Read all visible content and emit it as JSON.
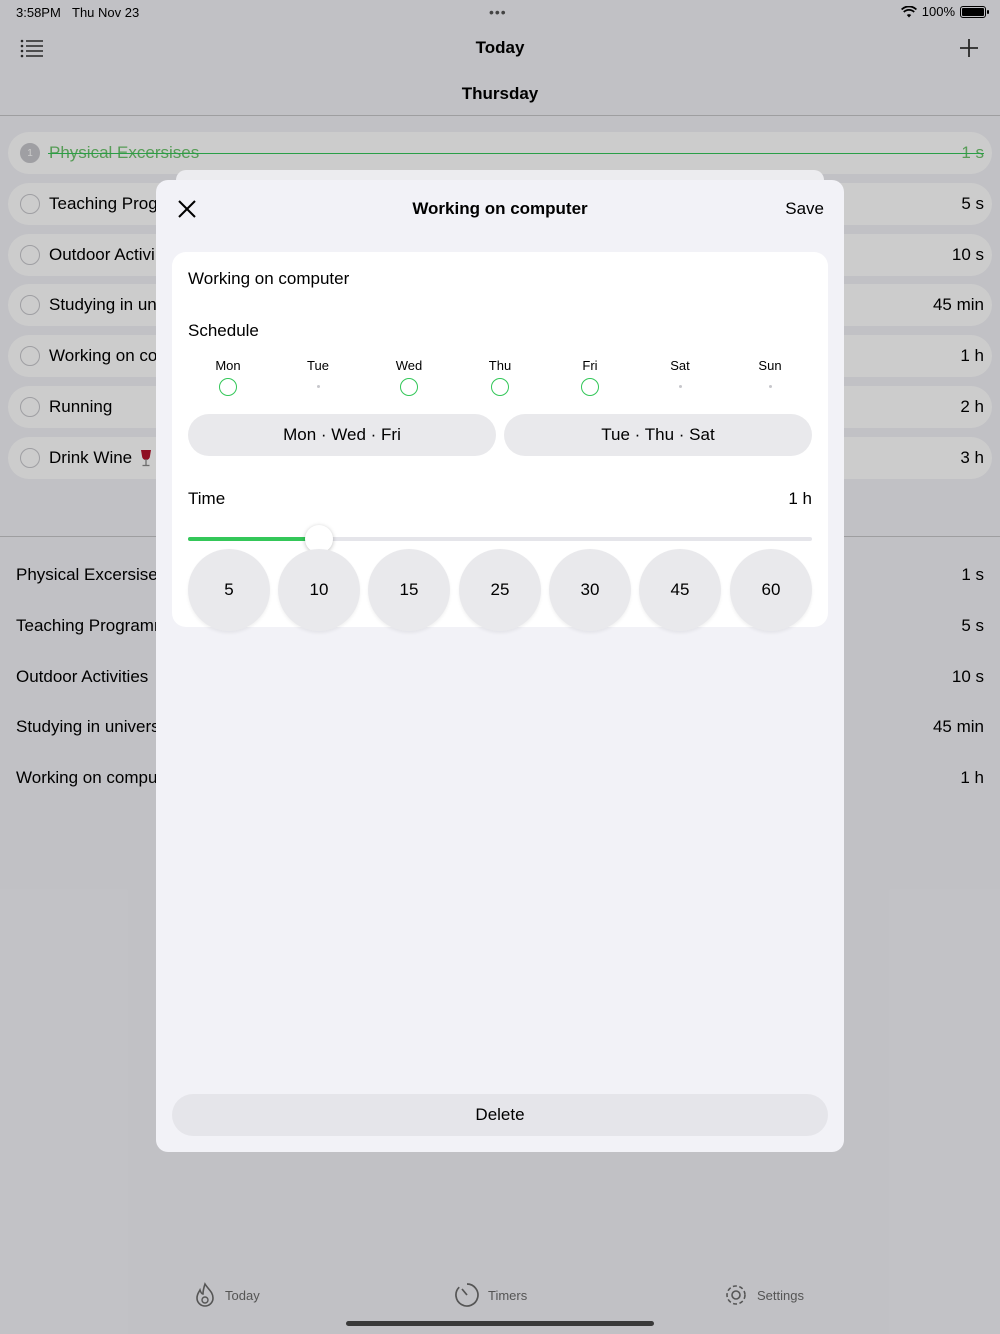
{
  "status_bar": {
    "time": "3:58PM",
    "date": "Thu Nov 23",
    "battery": "100%"
  },
  "nav": {
    "title": "Today",
    "day": "Thursday"
  },
  "tasks": [
    {
      "name": "Physical Excersises",
      "time": "1 s",
      "done": true,
      "index": "1"
    },
    {
      "name": "Teaching Prog",
      "time": "5 s"
    },
    {
      "name": "Outdoor Activi",
      "time": "10 s"
    },
    {
      "name": "Studying in un",
      "time": "45 min"
    },
    {
      "name": "Working on co",
      "time": "1 h"
    },
    {
      "name": "Running",
      "time": "2 h"
    },
    {
      "name": "Drink Wine",
      "time": "3 h"
    }
  ],
  "timers": [
    {
      "name": "Physical Excersises",
      "time": "1 s"
    },
    {
      "name": "Teaching Programr",
      "time": "5 s"
    },
    {
      "name": "Outdoor Activities",
      "time": "10 s"
    },
    {
      "name": "Studying in univers",
      "time": "45 min"
    },
    {
      "name": "Working on compu",
      "time": "1 h"
    }
  ],
  "tabs": {
    "today": "Today",
    "timers": "Timers",
    "settings": "Settings"
  },
  "modal": {
    "title": "Working on computer",
    "save": "Save",
    "name_value": "Working on computer",
    "schedule_label": "Schedule",
    "days": [
      {
        "label": "Mon",
        "active": true
      },
      {
        "label": "Tue",
        "active": false
      },
      {
        "label": "Wed",
        "active": true
      },
      {
        "label": "Thu",
        "active": true
      },
      {
        "label": "Fri",
        "active": true
      },
      {
        "label": "Sat",
        "active": false
      },
      {
        "label": "Sun",
        "active": false
      }
    ],
    "preset_1": "Mon · Wed · Fri",
    "preset_2": "Tue · Thu · Sat",
    "time_label": "Time",
    "time_value": "1 h",
    "slider_fraction": 0.21,
    "minutes": [
      "5",
      "10",
      "15",
      "25",
      "30",
      "45",
      "60"
    ],
    "delete": "Delete"
  },
  "colors": {
    "accent": "#34c759",
    "background": "#f2f2f7"
  }
}
